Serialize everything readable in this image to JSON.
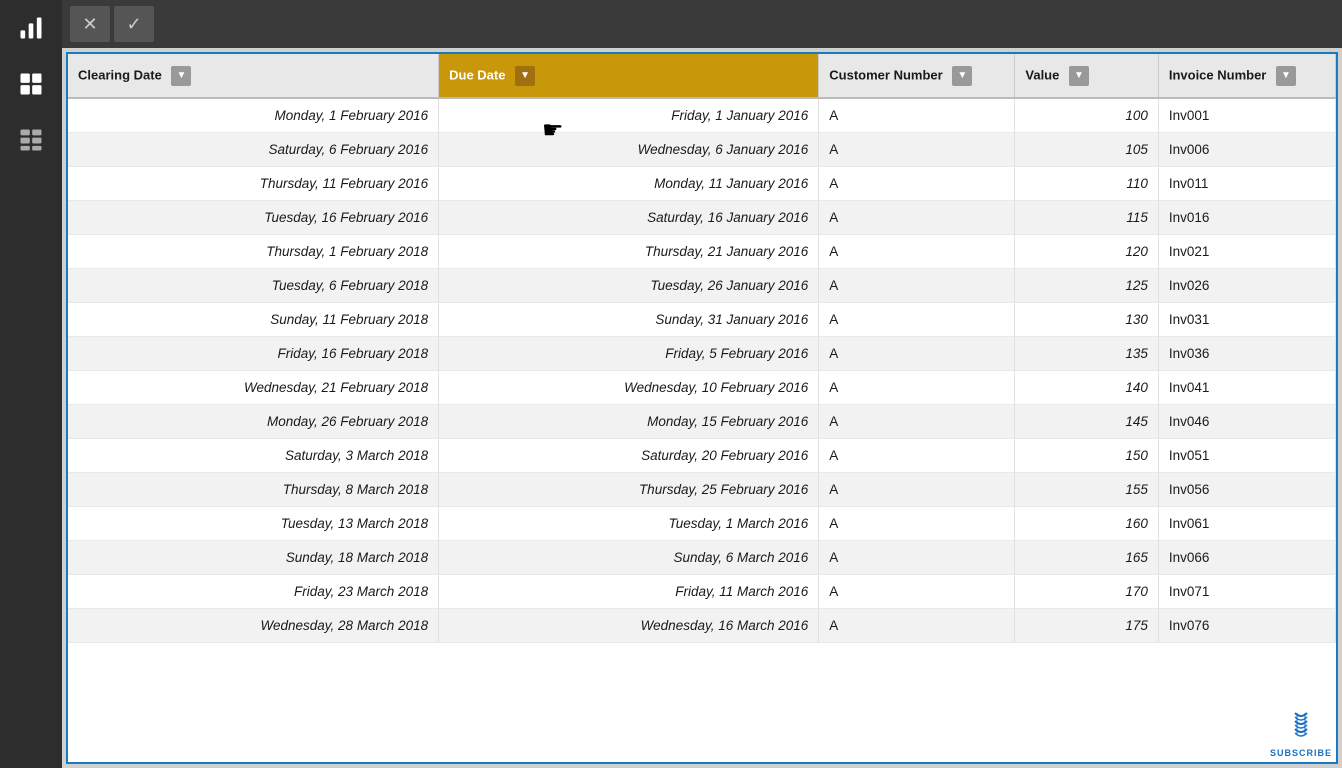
{
  "sidebar": {
    "icons": [
      {
        "name": "chart-bar-icon",
        "label": "Chart"
      },
      {
        "name": "table-grid-icon",
        "label": "Table"
      },
      {
        "name": "layout-icon",
        "label": "Layout"
      }
    ]
  },
  "toolbar": {
    "buttons": [
      {
        "name": "close-button",
        "label": "✕"
      },
      {
        "name": "confirm-button",
        "label": "✓"
      }
    ]
  },
  "table": {
    "columns": [
      {
        "key": "clearing_date",
        "label": "Clearing Date",
        "active": false
      },
      {
        "key": "due_date",
        "label": "Due Date",
        "active": true
      },
      {
        "key": "customer_number",
        "label": "Customer Number",
        "active": false
      },
      {
        "key": "value",
        "label": "Value",
        "active": false
      },
      {
        "key": "invoice_number",
        "label": "Invoice Number",
        "active": false
      }
    ],
    "rows": [
      {
        "clearing_date": "Monday, 1 February 2016",
        "due_date": "Friday, 1 January 2016",
        "customer_number": "A",
        "value": "100",
        "invoice_number": "Inv001"
      },
      {
        "clearing_date": "Saturday, 6 February 2016",
        "due_date": "Wednesday, 6 January 2016",
        "customer_number": "A",
        "value": "105",
        "invoice_number": "Inv006"
      },
      {
        "clearing_date": "Thursday, 11 February 2016",
        "due_date": "Monday, 11 January 2016",
        "customer_number": "A",
        "value": "110",
        "invoice_number": "Inv011"
      },
      {
        "clearing_date": "Tuesday, 16 February 2016",
        "due_date": "Saturday, 16 January 2016",
        "customer_number": "A",
        "value": "115",
        "invoice_number": "Inv016"
      },
      {
        "clearing_date": "Thursday, 1 February 2018",
        "due_date": "Thursday, 21 January 2016",
        "customer_number": "A",
        "value": "120",
        "invoice_number": "Inv021"
      },
      {
        "clearing_date": "Tuesday, 6 February 2018",
        "due_date": "Tuesday, 26 January 2016",
        "customer_number": "A",
        "value": "125",
        "invoice_number": "Inv026"
      },
      {
        "clearing_date": "Sunday, 11 February 2018",
        "due_date": "Sunday, 31 January 2016",
        "customer_number": "A",
        "value": "130",
        "invoice_number": "Inv031"
      },
      {
        "clearing_date": "Friday, 16 February 2018",
        "due_date": "Friday, 5 February 2016",
        "customer_number": "A",
        "value": "135",
        "invoice_number": "Inv036"
      },
      {
        "clearing_date": "Wednesday, 21 February 2018",
        "due_date": "Wednesday, 10 February 2016",
        "customer_number": "A",
        "value": "140",
        "invoice_number": "Inv041"
      },
      {
        "clearing_date": "Monday, 26 February 2018",
        "due_date": "Monday, 15 February 2016",
        "customer_number": "A",
        "value": "145",
        "invoice_number": "Inv046"
      },
      {
        "clearing_date": "Saturday, 3 March 2018",
        "due_date": "Saturday, 20 February 2016",
        "customer_number": "A",
        "value": "150",
        "invoice_number": "Inv051"
      },
      {
        "clearing_date": "Thursday, 8 March 2018",
        "due_date": "Thursday, 25 February 2016",
        "customer_number": "A",
        "value": "155",
        "invoice_number": "Inv056"
      },
      {
        "clearing_date": "Tuesday, 13 March 2018",
        "due_date": "Tuesday, 1 March 2016",
        "customer_number": "A",
        "value": "160",
        "invoice_number": "Inv061"
      },
      {
        "clearing_date": "Sunday, 18 March 2018",
        "due_date": "Sunday, 6 March 2016",
        "customer_number": "A",
        "value": "165",
        "invoice_number": "Inv066"
      },
      {
        "clearing_date": "Friday, 23 March 2018",
        "due_date": "Friday, 11 March 2016",
        "customer_number": "A",
        "value": "170",
        "invoice_number": "Inv071"
      },
      {
        "clearing_date": "Wednesday, 28 March 2018",
        "due_date": "Wednesday, 16 March 2016",
        "customer_number": "A",
        "value": "175",
        "invoice_number": "Inv076"
      }
    ]
  },
  "subscribe": {
    "label": "SUBSCRIBE"
  }
}
